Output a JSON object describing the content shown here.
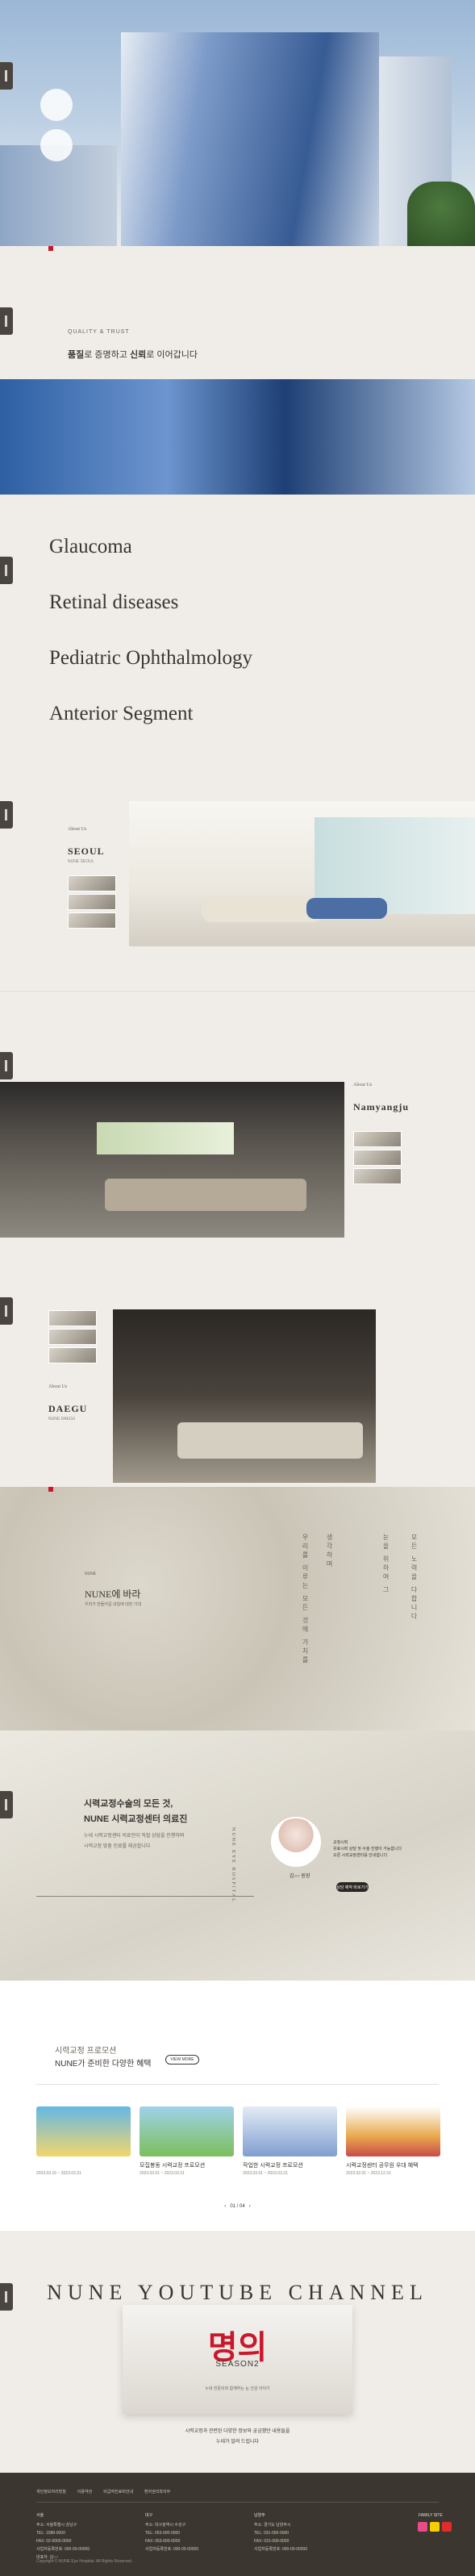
{
  "hero": {
    "badges": [
      "",
      ""
    ]
  },
  "quality": {
    "eyebrow": "QUALITY & TRUST",
    "slogan_pre": "품질",
    "slogan_mid": "로 증명하고 ",
    "slogan_em": "신뢰",
    "slogan_post": "로 이어갑니다"
  },
  "specialties": [
    "Glaucoma",
    "Retinal diseases",
    "Pediatric Ophthalmology",
    "Anterior Segment"
  ],
  "branches": {
    "seoul": {
      "about": "About Us",
      "city": "SEOUL",
      "sub": "NUNE SEOUL"
    },
    "namyangju": {
      "about": "About Us",
      "city": "Namyangju"
    },
    "daegu": {
      "about": "About Us",
      "city": "DAEGU",
      "sub": "NUNE DAEGU"
    }
  },
  "nune": {
    "eyebrow": "NUNE",
    "title": "NUNE에 바라",
    "sub": "우리가 만들어갈 내일에 대한 기대",
    "vertical": [
      "우리를 이루는 모든 것에 가치를",
      "생각하며",
      "눈을 위하여 그",
      "모든 노력을 다합니다"
    ]
  },
  "lasik": {
    "title_1": "시력교정수술의 모든 것,",
    "title_2": "NUNE 시력교정센터 의료진",
    "p1": "누네 시력교정센터 의료진이 직접 상담을 진행하며",
    "p2": "시력교정 맞춤 진료를 제공합니다",
    "signature": "NUNE EYE HOSPITAL",
    "doctor": "김○○ 원장",
    "q1": "교정시력",
    "q2": "유효시력 상담 및 수술 진행이 가능합니다",
    "q3": "오른 시력교정센터를 안내합니다",
    "button": "상담 예약 바로가기"
  },
  "promo": {
    "label": "시력교정 프로모션",
    "title": "NUNE가 준비한 다양한 혜택",
    "more": "VIEW MORE",
    "cards": [
      {
        "title": "",
        "date": "2023.03.15 ~ 2023.03.31"
      },
      {
        "title": "모집봉동 시력교정 프로모션",
        "date": "2023.03.01 ~ 2023.03.31"
      },
      {
        "title": "작업한 시력교정 프로모션",
        "date": "2023.03.01 ~ 2023.03.31"
      },
      {
        "title": "시력교정센터 공무원 우대 혜택",
        "date": "2023.02.01 ~ 2023.12.31"
      }
    ],
    "pager": "01 / 04"
  },
  "youtube": {
    "heading": "NUNE YOUTUBE CHANNEL",
    "video_title": "명의",
    "video_season": "SEASON2",
    "video_caption": "누네 전문의와 함께하는 눈 건강 이야기",
    "line1": "시력교정과 관련된 다양한 정보와 궁금했던 내용들을",
    "line2": "누네가 알려 드립니다"
  },
  "footer": {
    "links": [
      "개인정보처리방침",
      "이용약관",
      "비급여진료비안내",
      "환자권리와의무"
    ],
    "cols": [
      {
        "h": "서울",
        "lines": [
          "주소: 서울특별시 강남구",
          "TEL: 1588-0000",
          "FAX: 02-0000-0000",
          "사업자등록번호: 000-00-00000",
          "대표자: 김○○"
        ]
      },
      {
        "h": "대구",
        "lines": [
          "주소: 대구광역시 수성구",
          "TEL: 053-000-0000",
          "FAX: 053-000-0000",
          "사업자등록번호: 000-00-00000"
        ]
      },
      {
        "h": "남양주",
        "lines": [
          "주소: 경기도 남양주시",
          "TEL: 031-000-0000",
          "FAX: 031-000-0000",
          "사업자등록번호: 000-00-00000"
        ]
      }
    ],
    "family": "FAMILY SITE",
    "copyright": "Copyright © NUNE Eye Hospital. All Rights Reserved."
  },
  "colors": {
    "accent": "#c9182b",
    "dark": "#3b362f",
    "bg": "#f0ede8"
  }
}
